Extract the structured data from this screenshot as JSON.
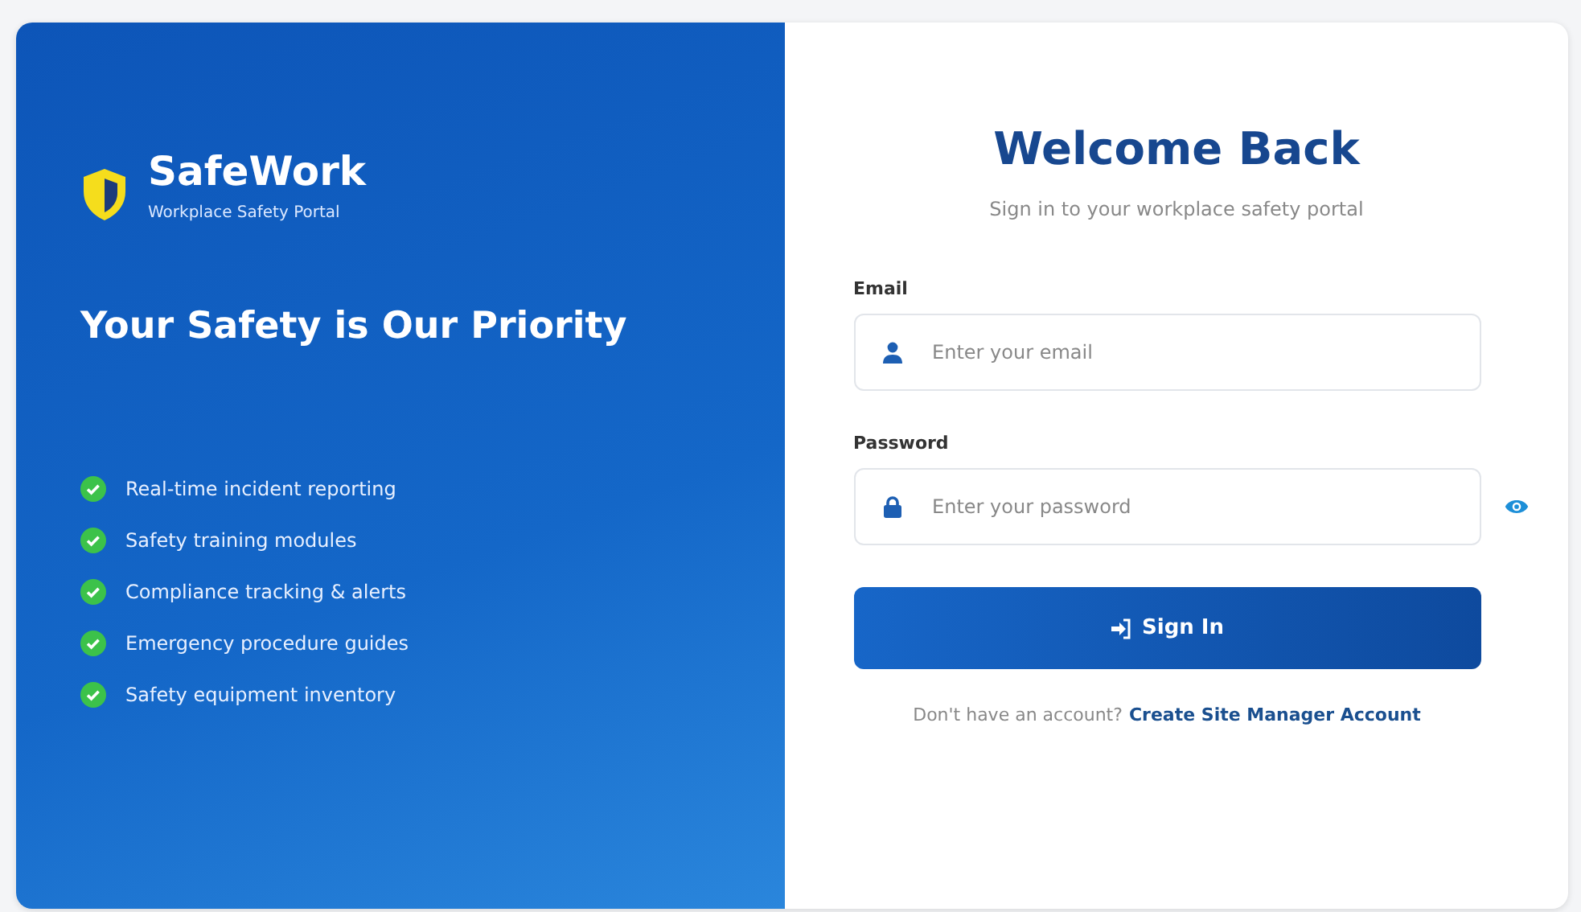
{
  "brand": {
    "name": "SafeWork",
    "tagline": "Workplace Safety Portal"
  },
  "headline": "Your Safety is Our Priority",
  "features": [
    {
      "label": "Real-time incident reporting"
    },
    {
      "label": "Safety training modules"
    },
    {
      "label": "Compliance tracking & alerts"
    },
    {
      "label": "Emergency procedure guides"
    },
    {
      "label": "Safety equipment inventory"
    }
  ],
  "form": {
    "title": "Welcome Back",
    "subtitle": "Sign in to your workplace safety portal",
    "fields": [
      {
        "kind": "email",
        "label": "Email",
        "placeholder": "Enter your email"
      },
      {
        "kind": "password",
        "label": "Password",
        "placeholder": "Enter your password"
      }
    ],
    "submit": "Sign In",
    "footer": {
      "text": "Don't have an account?",
      "link": "Create Site Manager Account"
    }
  }
}
